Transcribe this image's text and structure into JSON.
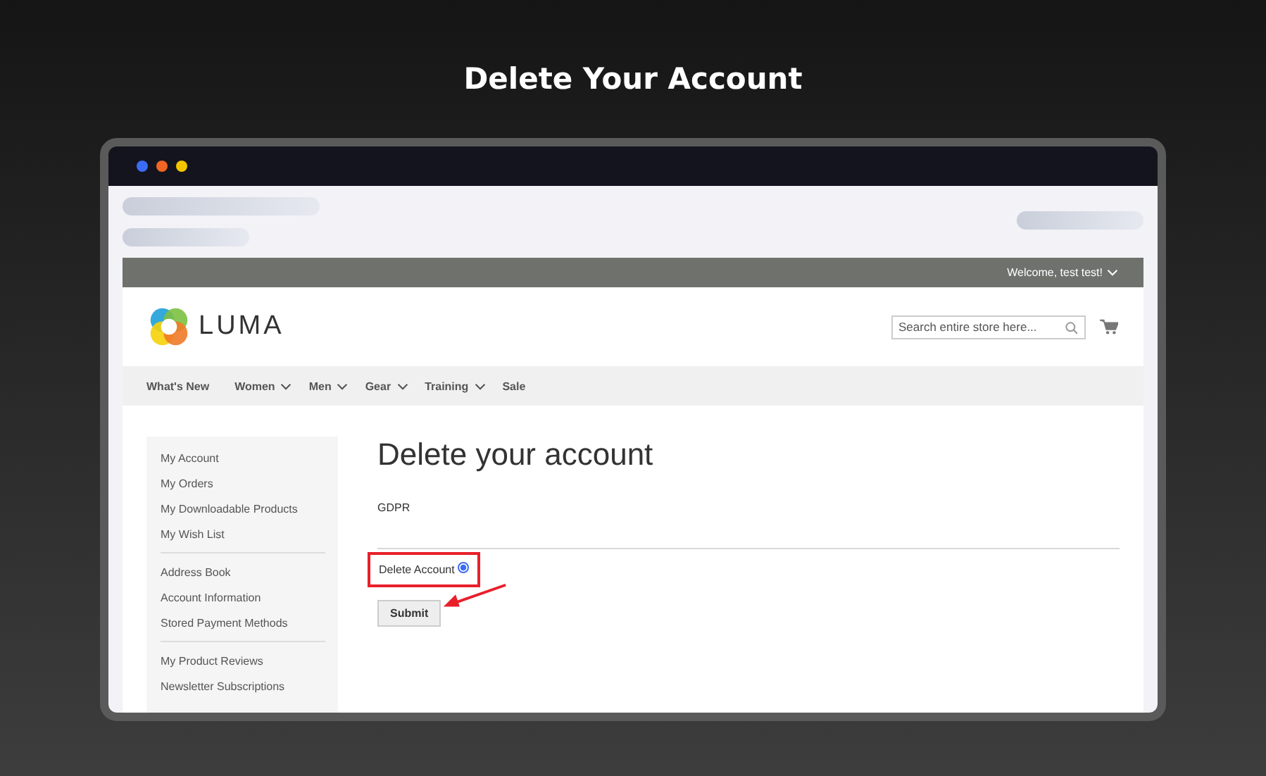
{
  "heading": "Delete Your Account",
  "store": {
    "welcome": "Welcome, test test!",
    "logo": "LUMA",
    "search": {
      "placeholder": "Search entire store here..."
    },
    "nav": [
      {
        "label": "What's New",
        "dropdown": false
      },
      {
        "label": "Women",
        "dropdown": true
      },
      {
        "label": "Men",
        "dropdown": true
      },
      {
        "label": "Gear",
        "dropdown": true
      },
      {
        "label": "Training",
        "dropdown": true
      },
      {
        "label": "Sale",
        "dropdown": false
      }
    ],
    "sidebar": {
      "groups": [
        [
          "My Account",
          "My Orders",
          "My Downloadable Products",
          "My Wish List"
        ],
        [
          "Address Book",
          "Account Information",
          "Stored Payment Methods"
        ],
        [
          "My Product Reviews",
          "Newsletter Subscriptions"
        ]
      ]
    },
    "page_title": "Delete your account",
    "section": "GDPR",
    "option": {
      "label": "Delete Account",
      "checked": true,
      "highlighted": true
    },
    "button": {
      "label": "Submit",
      "pointed": true
    }
  }
}
